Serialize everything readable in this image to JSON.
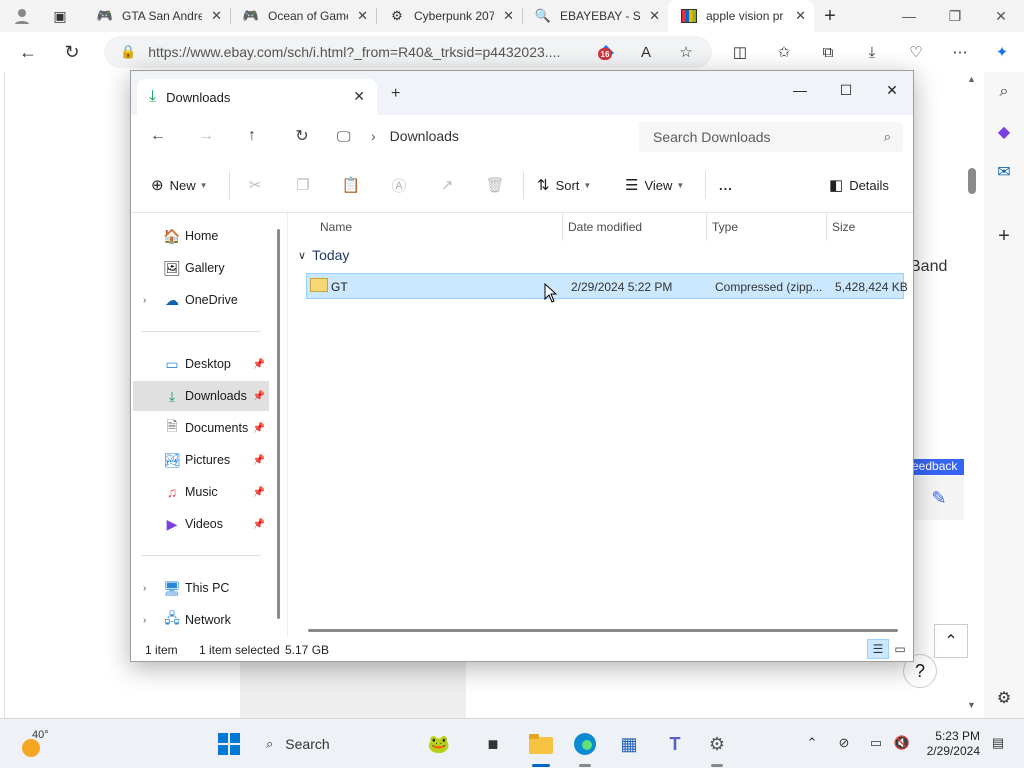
{
  "browser": {
    "tabs": [
      {
        "title": "GTA San Andre",
        "icon": "gamepad-icon"
      },
      {
        "title": "Ocean of Game",
        "icon": "gamepad-icon"
      },
      {
        "title": "Cyberpunk 207",
        "icon": "gear-icon"
      },
      {
        "title": "EBAYEBAY - Se",
        "icon": "search-icon"
      },
      {
        "title": "apple vision pr",
        "icon": "ebay-icon"
      }
    ],
    "url": "https://www.ebay.com/sch/i.html?_from=R40&_trksid=p4432023....",
    "extension_badge": "16"
  },
  "page": {
    "band_text": "Band",
    "feedback_label": "eedback"
  },
  "explorer": {
    "tab_title": "Downloads",
    "breadcrumb": "Downloads",
    "search_placeholder": "Search Downloads",
    "commands": {
      "new": "New",
      "sort": "Sort",
      "view": "View",
      "more": "...",
      "details": "Details"
    },
    "sidebar": {
      "quick": [
        {
          "label": "Home",
          "icon": "home-icon",
          "expandable": false
        },
        {
          "label": "Gallery",
          "icon": "gallery-icon",
          "expandable": false
        },
        {
          "label": "OneDrive",
          "icon": "cloud-icon",
          "expandable": true
        }
      ],
      "pinned": [
        {
          "label": "Desktop",
          "icon": "desktop-icon"
        },
        {
          "label": "Downloads",
          "icon": "download-icon",
          "selected": true
        },
        {
          "label": "Documents",
          "icon": "documents-icon"
        },
        {
          "label": "Pictures",
          "icon": "pictures-icon"
        },
        {
          "label": "Music",
          "icon": "music-icon"
        },
        {
          "label": "Videos",
          "icon": "videos-icon"
        }
      ],
      "devices": [
        {
          "label": "This PC",
          "icon": "pc-icon"
        },
        {
          "label": "Network",
          "icon": "network-icon"
        }
      ]
    },
    "columns": {
      "name": "Name",
      "date": "Date modified",
      "type": "Type",
      "size": "Size"
    },
    "group_label": "Today",
    "files": [
      {
        "name": "GT",
        "date": "2/29/2024 5:22 PM",
        "type": "Compressed (zipp...",
        "size": "5,428,424 KB",
        "selected": true
      }
    ],
    "status": {
      "count": "1 item",
      "selection": "1 item selected",
      "size": "5.17 GB"
    }
  },
  "taskbar": {
    "temperature": "40°",
    "search_label": "Search",
    "time": "5:23 PM",
    "date": "2/29/2024"
  }
}
